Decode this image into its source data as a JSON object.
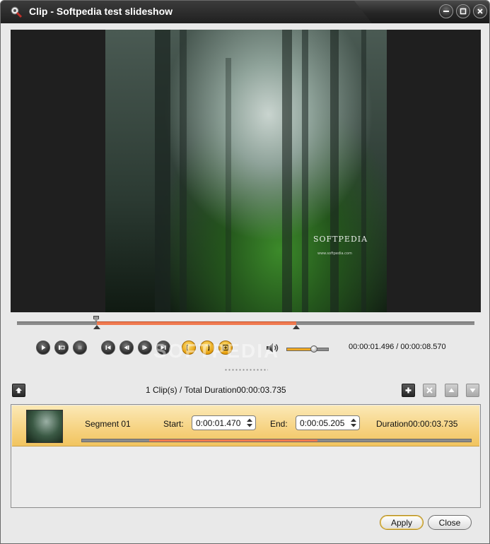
{
  "window": {
    "title": "Clip - Softpedia test slideshow"
  },
  "preview": {
    "image_brand_text": "SOFTPEDIA",
    "image_url_text": "www.softpedia.com"
  },
  "timeline": {
    "selection_start_fraction": 0.175,
    "selection_end_fraction": 0.61
  },
  "controls": {
    "play": "play-icon",
    "snapshot": "snapshot-icon",
    "stop": "stop-icon",
    "go_start": "skip-start-icon",
    "step_back": "step-back-icon",
    "step_forward": "step-forward-icon",
    "go_end": "skip-end-icon",
    "set_start": "mark-in-icon",
    "set_end": "mark-out-icon",
    "add_clip": "add-clip-icon",
    "volume": "speaker-icon",
    "volume_level": 0.62,
    "time_readout": "00:00:01.496 / 00:00:08.570"
  },
  "watermark": "SOFTPEDIA",
  "clip_list": {
    "summary": "1 Clip(s) /  Total Duration00:00:03.735",
    "rows": [
      {
        "name": "Segment 01",
        "start_label": "Start:",
        "start_value": "0:00:01.470",
        "end_label": "End:",
        "end_value": "0:00:05.205",
        "duration": "Duration00:00:03.735",
        "selection_start_fraction": 0.173,
        "selection_end_fraction": 0.605
      }
    ]
  },
  "footer": {
    "apply_label": "Apply",
    "close_label": "Close"
  },
  "colors": {
    "accent": "#f0a820",
    "selection": "#f07a50",
    "row_highlight": "#f6d280",
    "title_bar": "#262626"
  }
}
